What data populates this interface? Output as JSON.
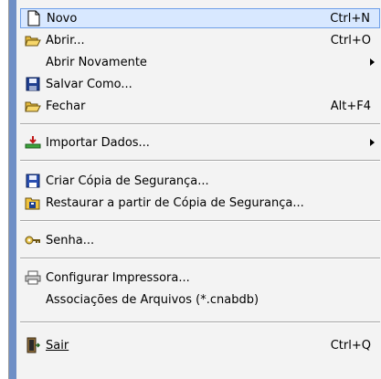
{
  "menu": {
    "items": [
      {
        "label": "Novo",
        "shortcut": "Ctrl+N",
        "icon": "new-document-icon",
        "highlighted": true
      },
      {
        "label": "Abrir...",
        "shortcut": "Ctrl+O",
        "icon": "open-folder-icon"
      },
      {
        "label": "Abrir Novamente",
        "submenu": true
      },
      {
        "label": "Salvar Como...",
        "icon": "save-disk-icon"
      },
      {
        "label": "Fechar",
        "shortcut": "Alt+F4",
        "icon": "close-folder-icon"
      },
      {
        "label": "Importar Dados...",
        "submenu": true,
        "icon": "import-data-icon"
      },
      {
        "label": "Criar Cópia de Segurança...",
        "icon": "backup-disk-icon"
      },
      {
        "label": "Restaurar a partir de Cópia de Segurança...",
        "icon": "restore-folder-icon"
      },
      {
        "label": "Senha...",
        "icon": "key-icon"
      },
      {
        "label": "Configurar Impressora...",
        "icon": "printer-icon"
      },
      {
        "label": "Associações de Arquivos (*.cnabdb)"
      },
      {
        "label": "Sair",
        "shortcut": "Ctrl+Q",
        "icon": "exit-door-icon"
      }
    ]
  },
  "colors": {
    "highlight_bg": "#d8e8ff",
    "highlight_border": "#6fa0e8",
    "menu_bg": "#f3f3f3",
    "gutter": "#6f8fc6"
  }
}
